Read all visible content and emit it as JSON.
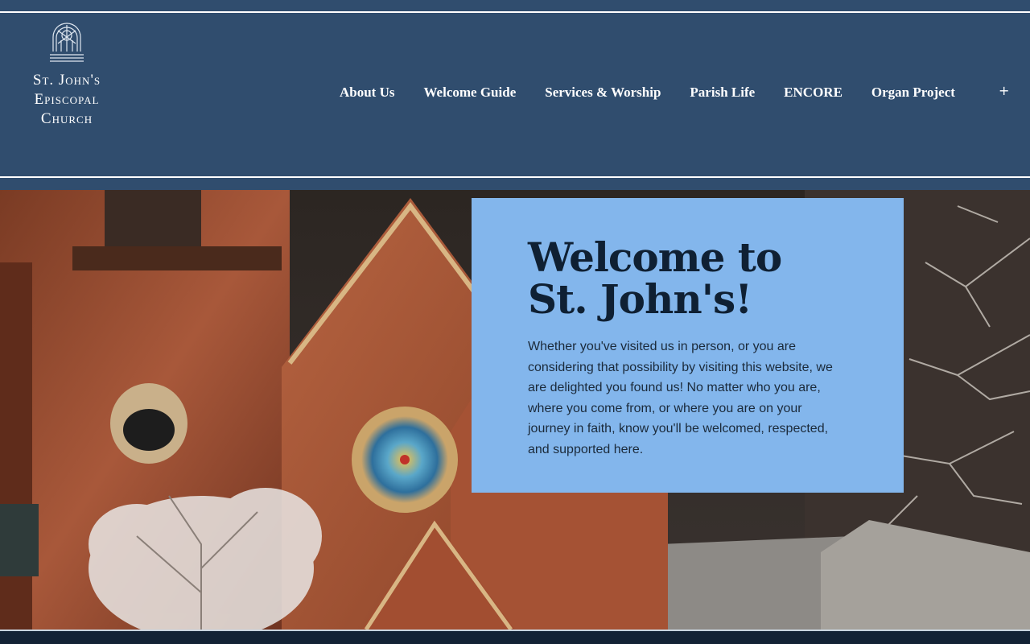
{
  "logo": {
    "lines": [
      "St. John's",
      "Episcopal",
      "Church"
    ]
  },
  "nav": {
    "items": [
      {
        "label": "About Us"
      },
      {
        "label": "Welcome Guide"
      },
      {
        "label": "Services & Worship"
      },
      {
        "label": "Parish Life"
      },
      {
        "label": "ENCORE"
      },
      {
        "label": "Organ Project"
      }
    ],
    "more_label": "+"
  },
  "hero": {
    "title_line1": "Welcome to",
    "title_line2": "St. John's!",
    "body": "Whether you've visited us in person, or you are considering that possibility by visiting this website, we are delighted you found us! No matter who you are, where you come from, or where you are on your journey in faith, know you'll be welcomed, respected, and supported here."
  },
  "colors": {
    "header_bg": "#304d6e",
    "welcome_box": "#83b6ec",
    "title_text": "#0f2033"
  }
}
